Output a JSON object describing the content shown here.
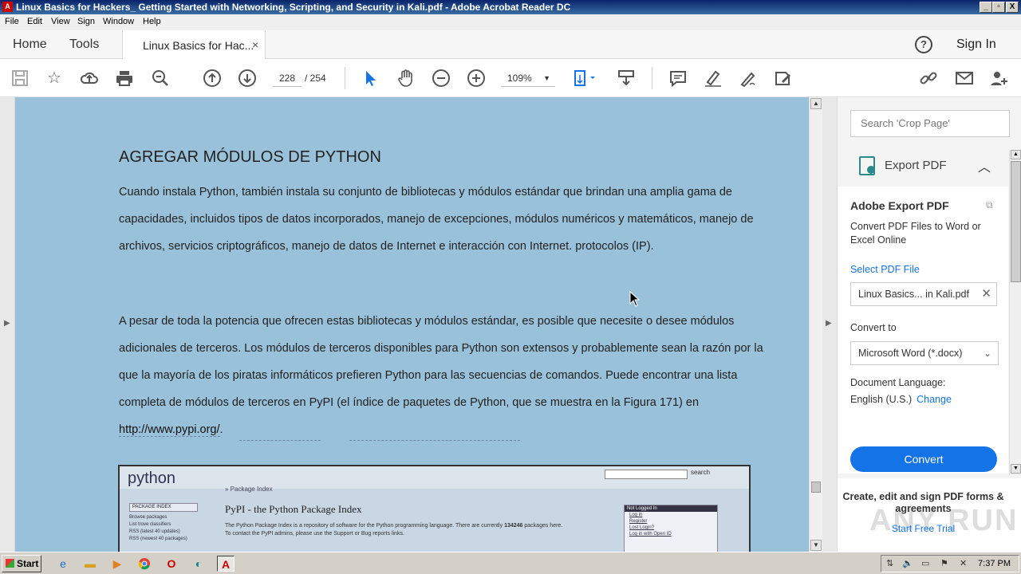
{
  "window": {
    "title": "Linux Basics for Hackers_ Getting Started with Networking, Scripting, and Security in Kali.pdf - Adobe Acrobat Reader DC",
    "controls": {
      "minimize": "_",
      "restore": "▫",
      "close": "X"
    }
  },
  "menu": [
    "File",
    "Edit",
    "View",
    "Sign",
    "Window",
    "Help"
  ],
  "tabs": {
    "home": "Home",
    "tools": "Tools",
    "document": "Linux Basics for Hac...",
    "close": "×",
    "sign_in": "Sign In"
  },
  "toolbar": {
    "page_current": "228",
    "page_total": "/   254",
    "zoom": "109%"
  },
  "page": {
    "heading": "AGREGAR MÓDULOS DE PYTHON",
    "para1": "Cuando instala Python, también instala su conjunto de bibliotecas y módulos estándar que brindan una amplia gama de capacidades, incluidos tipos de datos incorporados, manejo de excepciones, módulos numéricos y matemáticos, manejo de archivos, servicios criptográficos, manejo de datos de Internet e interacción con Internet. protocolos (IP).",
    "para2": "A pesar de toda la potencia que ofrecen estas bibliotecas y módulos estándar, es posible que necesite o desee módulos adicionales de terceros. Los módulos de terceros disponibles para Python son extensos y probablemente sean la razón por la que la mayoría de los piratas informáticos prefieren Python para las secuencias de comandos. Puede encontrar una lista completa de módulos de terceros en PyPI (el índice de paquetes de Python, que se muestra en la Figura 171) en ",
    "para2_link": "http://www.pypi.org/",
    "para2_end": "."
  },
  "figure": {
    "logo": "python",
    "search_btn": "search",
    "breadcrumb": "» Package Index",
    "side_head": "PACKAGE INDEX",
    "side_items": [
      "Browse packages",
      "List trove classifiers",
      "RSS (latest 40 updates)",
      "RSS (newest 40 packages)"
    ],
    "title": "PyPI - the Python Package Index",
    "text1": "The Python Package Index is a repository of software for the Python programming language. There are currently",
    "count": "134246",
    "text1_end": "packages here.",
    "text2": "To contact the PyPI admins, please use the Support or Bug reports links.",
    "box_head": "Not Logged In",
    "box_links": [
      "Log in",
      "Register",
      "Lost Login?",
      "Log in with Open ID"
    ]
  },
  "right_panel": {
    "search_placeholder": "Search 'Crop Page'",
    "export_header": "Export PDF",
    "export_title": "Adobe Export PDF",
    "export_desc": "Convert PDF Files to Word or Excel Online",
    "select_file": "Select PDF File",
    "file_name": "Linux Basics... in Kali.pdf",
    "convert_to_label": "Convert to",
    "convert_to_value": "Microsoft Word (*.docx)",
    "doc_lang_label": "Document Language:",
    "doc_lang_value": "English (U.S.)",
    "change": "Change",
    "convert_button": "Convert",
    "promo_text": "Create, edit and sign PDF forms & agreements",
    "promo_link": "Start Free Trial",
    "watermark": "ANY RUN"
  },
  "taskbar": {
    "start": "Start",
    "clock": "7:37 PM"
  },
  "colors": {
    "accent": "#1473e6",
    "page_bg": "#99c1da",
    "title_bar": "#0a246a"
  }
}
